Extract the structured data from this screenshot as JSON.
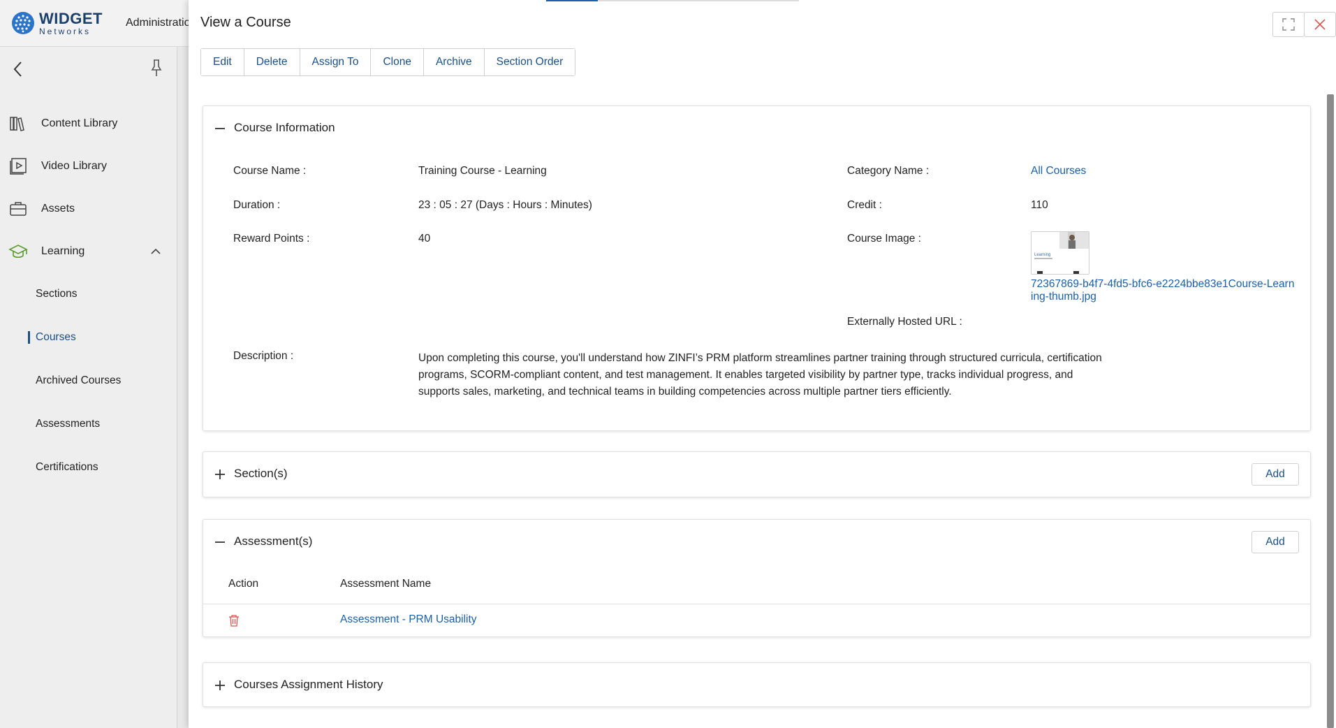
{
  "app": {
    "logo_name": "WIDGET",
    "logo_sub": "Networks",
    "admin_label": "Administration"
  },
  "sidebar": {
    "items": [
      {
        "label": "Content Library",
        "icon": "books-icon"
      },
      {
        "label": "Video Library",
        "icon": "video-icon"
      },
      {
        "label": "Assets",
        "icon": "briefcase-icon"
      },
      {
        "label": "Learning",
        "icon": "graduation-cap-icon",
        "expanded": true
      }
    ],
    "sub_items": [
      {
        "label": "Sections",
        "active": false
      },
      {
        "label": "Courses",
        "active": true
      },
      {
        "label": "Archived Courses",
        "active": false
      },
      {
        "label": "Assessments",
        "active": false
      },
      {
        "label": "Certifications",
        "active": false
      }
    ]
  },
  "panel": {
    "title": "View a Course"
  },
  "toolbar": {
    "edit": "Edit",
    "delete": "Delete",
    "assign_to": "Assign To",
    "clone": "Clone",
    "archive": "Archive",
    "section_order": "Section Order"
  },
  "course_info": {
    "title": "Course Information",
    "expanded": true,
    "course_name_label": "Course Name :",
    "course_name": "Training Course - Learning",
    "category_label": "Category Name :",
    "category": "All Courses",
    "duration_label": "Duration :",
    "duration": "23 : 05 : 27  (Days : Hours : Minutes)",
    "credit_label": "Credit :",
    "credit": "110",
    "reward_label": "Reward Points :",
    "reward": "40",
    "image_label": "Course Image :",
    "image_file": "72367869-b4f7-4fd5-bfc6-e2224bbe83e1Course-Learning-thumb.jpg",
    "thumb_text": "Learning",
    "url_label": "Externally Hosted URL :",
    "url": "",
    "description_label": "Description :",
    "description": "Upon completing this course, you'll understand how ZINFI’s PRM platform streamlines partner training through structured curricula, certification programs, SCORM-compliant content, and test management. It enables targeted visibility by partner type, tracks individual progress, and supports sales, marketing, and technical teams in building competencies across multiple partner tiers efficiently."
  },
  "sections": {
    "title": "Section(s)",
    "expanded": false,
    "add_label": "Add"
  },
  "assessments": {
    "title": "Assessment(s)",
    "expanded": true,
    "add_label": "Add",
    "columns": [
      "Action",
      "Assessment Name"
    ],
    "rows": [
      {
        "action_icon": "trash-icon",
        "name": "Assessment - PRM Usability"
      }
    ]
  },
  "history": {
    "title": "Courses Assignment History",
    "expanded": false
  },
  "colors": {
    "accent": "#1a4f86",
    "link": "#1a5fa8",
    "danger": "#d9534f",
    "learning_icon": "#5a9a2e"
  }
}
